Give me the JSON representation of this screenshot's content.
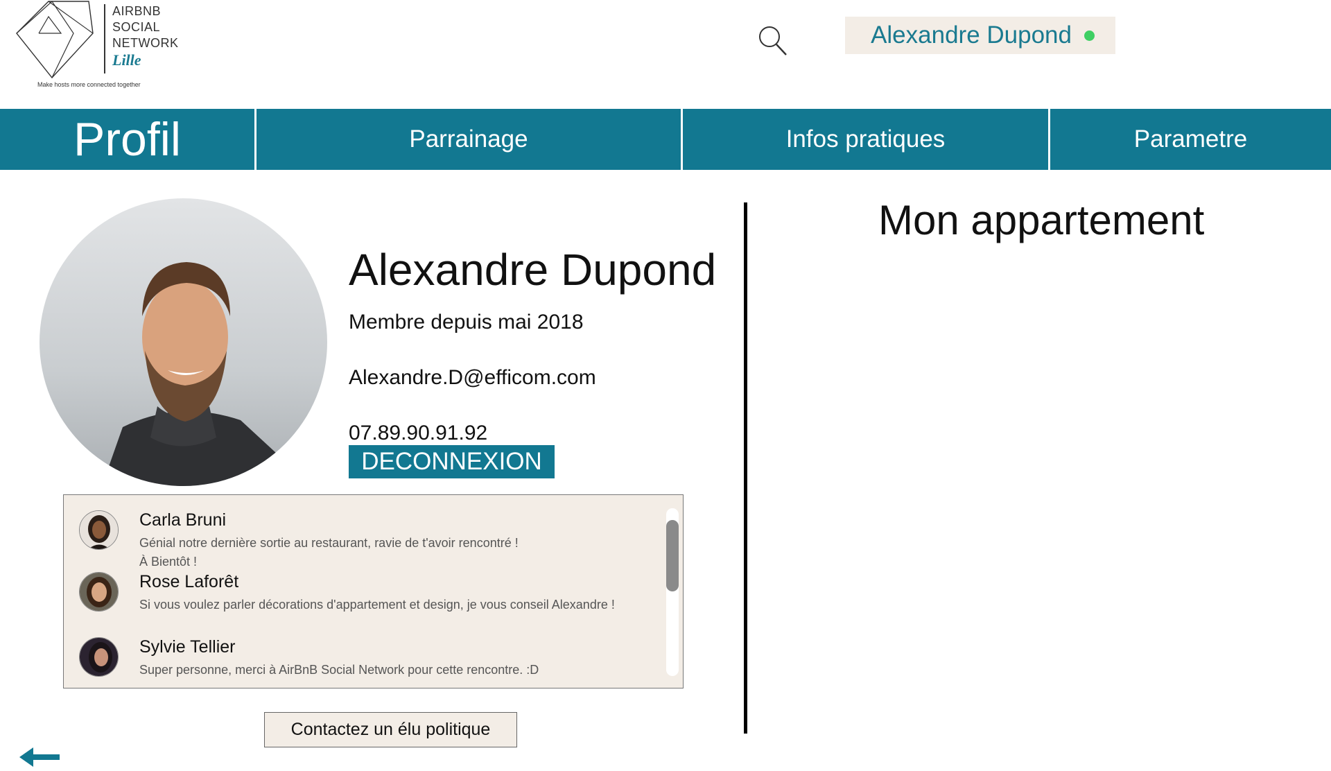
{
  "header": {
    "logo": {
      "lines": [
        "AIRBNB",
        "SOCIAL",
        "NETWORK"
      ],
      "city": "Lille",
      "tagline": "Make hosts more connected together"
    },
    "user_chip": {
      "name": "Alexandre Dupond",
      "status_color": "#3fcf63"
    }
  },
  "nav": {
    "items": [
      {
        "label": "Profil"
      },
      {
        "label": "Parrainage"
      },
      {
        "label": "Infos pratiques"
      },
      {
        "label": "Parametre"
      }
    ],
    "color": "#127891"
  },
  "profile": {
    "name": "Alexandre Dupond",
    "member_since": "Membre depuis mai 2018",
    "email": "Alexandre.D@efficom.com",
    "phone": "07.89.90.91.92",
    "logout_label": "DECONNEXION"
  },
  "comments": [
    {
      "name": "Carla Bruni",
      "text": "Génial notre dernière sortie au restaurant, ravie de t'avoir rencontré !\nÀ Bientôt !"
    },
    {
      "name": "Rose Laforêt",
      "text": "Si vous voulez parler décorations d'appartement et design, je vous conseil Alexandre !"
    },
    {
      "name": "Sylvie Tellier",
      "text": "Super personne, merci à AirBnB Social Network pour cette rencontre. :D"
    }
  ],
  "contact_button": "Contactez un élu politique",
  "apartment": {
    "title": "Mon appartement"
  }
}
